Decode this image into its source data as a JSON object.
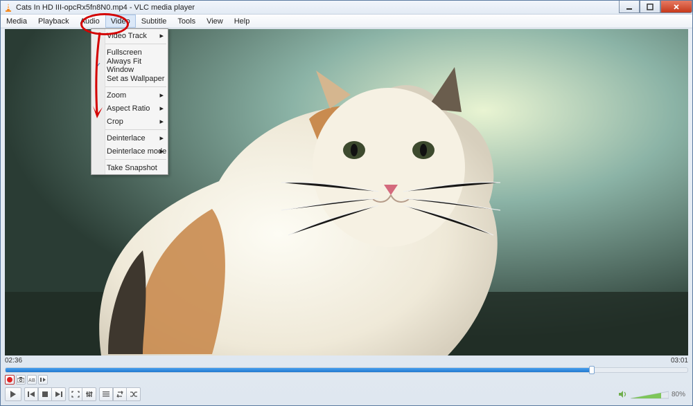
{
  "title": "Cats In HD III-opcRx5fn8N0.mp4 - VLC media player",
  "menus": {
    "media": "Media",
    "playback": "Playback",
    "audio": "Audio",
    "video": "Video",
    "subtitle": "Subtitle",
    "tools": "Tools",
    "view": "View",
    "help": "Help"
  },
  "video_menu": {
    "video_track": "Video Track",
    "fullscreen": "Fullscreen",
    "always_fit": "Always Fit Window",
    "set_wallpaper": "Set as Wallpaper",
    "zoom": "Zoom",
    "aspect_ratio": "Aspect Ratio",
    "crop": "Crop",
    "deinterlace": "Deinterlace",
    "deinterlace_mode": "Deinterlace mode",
    "take_snapshot": "Take Snapshot"
  },
  "time": {
    "current": "02:36",
    "total": "03:01"
  },
  "volume": {
    "percent": "80%"
  }
}
